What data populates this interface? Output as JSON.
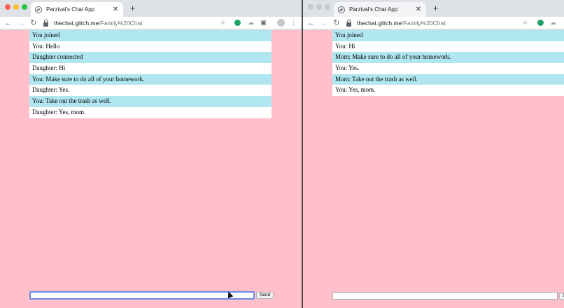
{
  "windows": [
    {
      "tab_title": "Parzival's Chat App",
      "url_host": "thechat.glitch.me",
      "url_path": "/Family%20Chat",
      "messages": [
        "You joined",
        "You: Hello",
        "Daughter connected",
        "Daughter: Hi",
        "You: Make sure to do all of your homework.",
        "Daughter: Yes.",
        "You: Take out the trash as well.",
        "Daughter: Yes, mom."
      ],
      "input_value": "",
      "send_label": "Send"
    },
    {
      "tab_title": "Parzival's Chat App",
      "url_host": "thechat.glitch.me",
      "url_path": "/Family%20Chat",
      "messages": [
        "You joined",
        "You: Hi",
        "Mom: Make sure to do all of your homework.",
        "You: Yes.",
        "Mom: Take out the trash as well.",
        "You: Yes, mom."
      ],
      "input_value": "",
      "send_label": "S"
    }
  ],
  "colors": {
    "page_background": "#ffc0cb",
    "message_row_alt": "#b0e6ef",
    "message_row": "#ffffff",
    "focused_input_border": "#6b8bf0"
  },
  "icons": {
    "back": "arrow-left-icon",
    "forward": "arrow-right-icon",
    "reload": "reload-icon",
    "lock": "lock-icon",
    "bookmark": "star-icon",
    "close_tab": "close-icon",
    "new_tab": "plus-icon",
    "menu": "kebab-menu-icon"
  }
}
